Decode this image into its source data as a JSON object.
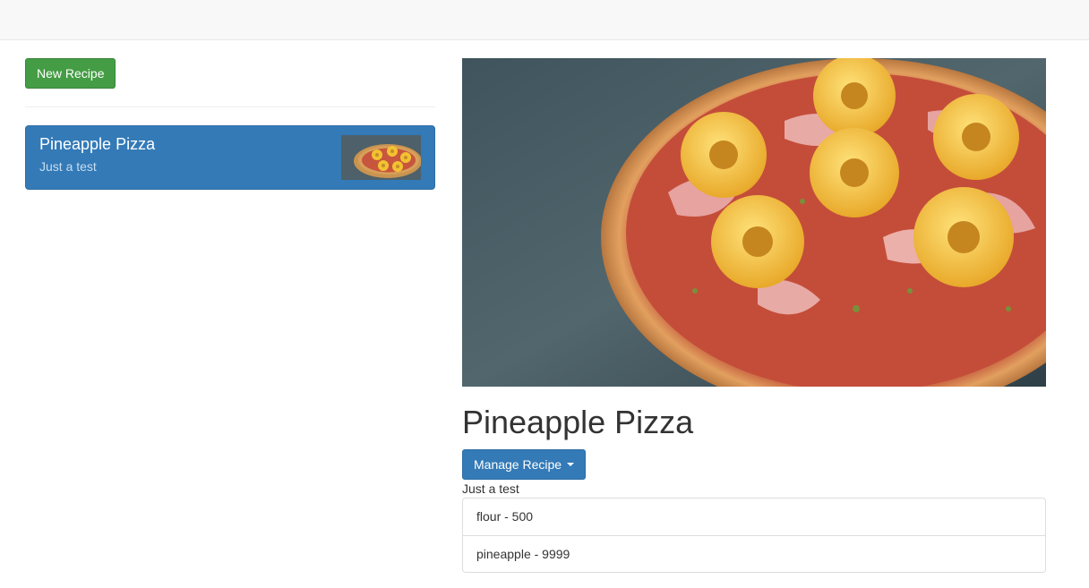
{
  "actions": {
    "new_recipe_label": "New Recipe"
  },
  "recipe_list": [
    {
      "name": "Pineapple Pizza",
      "description": "Just a test",
      "image": "pineapple-pizza-photo"
    }
  ],
  "detail": {
    "image": "pineapple-pizza-photo",
    "title": "Pineapple Pizza",
    "manage_label": "Manage Recipe",
    "description": "Just a test",
    "ingredients": [
      "flour - 500",
      "pineapple - 9999"
    ]
  },
  "colors": {
    "navbar_bg": "#f8f8f8",
    "success_green": "#449d44",
    "primary_blue": "#337ab7",
    "border": "#dddddd"
  }
}
